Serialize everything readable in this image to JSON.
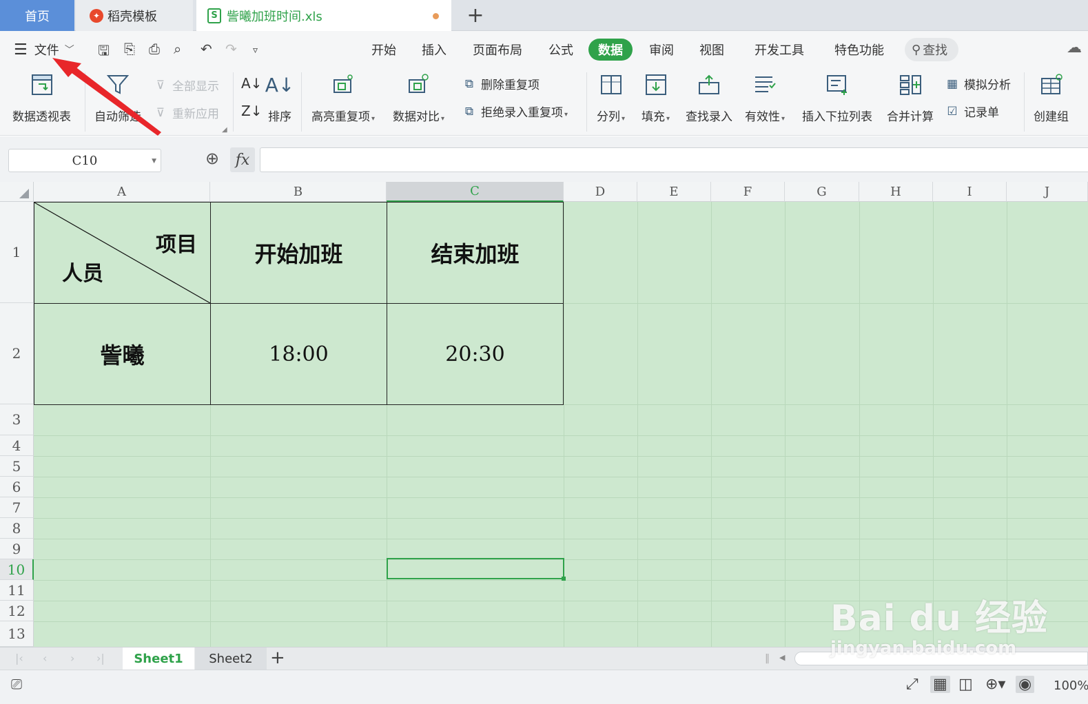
{
  "tabs": {
    "home": "首页",
    "template": "稻壳模板",
    "file": "訾曦加班时间.xls",
    "add": "+"
  },
  "menu": {
    "file_label": "文件",
    "tabs": [
      "开始",
      "插入",
      "页面布局",
      "公式",
      "数据",
      "审阅",
      "视图",
      "开发工具",
      "特色功能"
    ],
    "active_tab": "数据",
    "search_label": "查找"
  },
  "ribbon": {
    "pivot": "数据透视表",
    "autofilter": "自动筛选",
    "show_all": "全部显示",
    "reapply": "重新应用",
    "sort": "排序",
    "highlight_dup": "高亮重复项",
    "data_compare": "数据对比",
    "delete_dup": "删除重复项",
    "reject_dup": "拒绝录入重复项",
    "split": "分列",
    "fill": "填充",
    "lookup_entry": "查找录入",
    "validity": "有效性",
    "insert_dropdown": "插入下拉列表",
    "consolidate": "合并计算",
    "what_if": "模拟分析",
    "record_form": "记录单",
    "create_group": "创建组"
  },
  "formula_bar": {
    "cell_ref": "C10",
    "fx": "fx",
    "formula": ""
  },
  "sheet": {
    "columns": [
      "A",
      "B",
      "C",
      "D",
      "E",
      "F",
      "G",
      "H",
      "I",
      "J"
    ],
    "selected_column": "C",
    "rows": [
      "1",
      "2",
      "3",
      "4",
      "5",
      "6",
      "7",
      "8",
      "9",
      "10",
      "11",
      "12",
      "13"
    ],
    "selected_row": "10",
    "cells": {
      "A1_top": "项目",
      "A1_bottom": "人员",
      "B1": "开始加班",
      "C1": "结束加班",
      "A2": "訾曦",
      "B2": "18:00",
      "C2": "20:30"
    }
  },
  "sheet_tabs": [
    "Sheet1",
    "Sheet2"
  ],
  "active_sheet": "Sheet1",
  "status": {
    "zoom": "100%"
  },
  "watermark": {
    "main": "Bai du 经验",
    "sub": "jingyan.baidu.com"
  },
  "colors": {
    "accent": "#2fa24a",
    "sheet_bg": "#cde8cf",
    "home_tab": "#5b8fd9",
    "annotation_arrow": "#e8262a"
  }
}
